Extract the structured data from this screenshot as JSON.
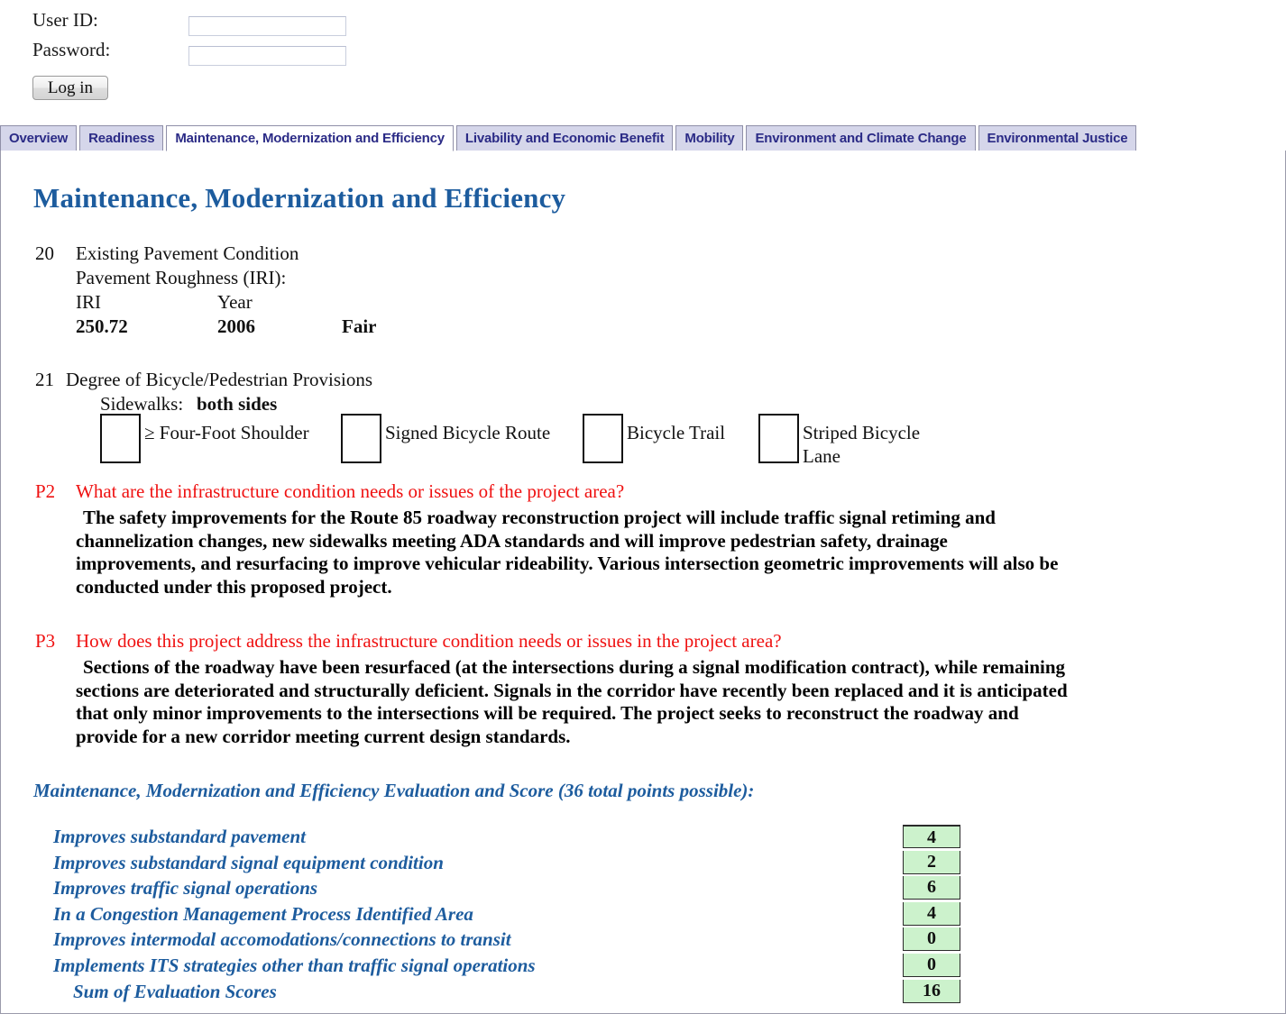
{
  "login": {
    "userid_label": "User ID:",
    "password_label": "Password:",
    "userid_value": "",
    "password_value": "",
    "userid_placeholder": "",
    "password_placeholder": "",
    "login_button": "Log in"
  },
  "tabs": [
    {
      "label": "Overview",
      "active": false
    },
    {
      "label": "Readiness",
      "active": false
    },
    {
      "label": "Maintenance, Modernization and Efficiency",
      "active": true
    },
    {
      "label": "Livability and Economic Benefit",
      "active": false
    },
    {
      "label": "Mobility",
      "active": false
    },
    {
      "label": "Environment and Climate Change",
      "active": false
    },
    {
      "label": "Environmental Justice",
      "active": false
    }
  ],
  "page": {
    "title": "Maintenance, Modernization and Efficiency"
  },
  "q20": {
    "number": "20",
    "title": "Existing Pavement Condition",
    "subtitle": "Pavement Roughness (IRI):",
    "header_iri": "IRI",
    "header_year": "Year",
    "value_iri": "250.72",
    "value_year": "2006",
    "value_rating": "Fair"
  },
  "q21": {
    "number": "21",
    "title": "Degree of Bicycle/Pedestrian Provisions",
    "sidewalks_label": "Sidewalks:",
    "sidewalks_value": "both sides",
    "checkboxes": [
      {
        "label": "≥ Four-Foot Shoulder",
        "checked": false
      },
      {
        "label": "Signed Bicycle Route",
        "checked": false
      },
      {
        "label": "Bicycle Trail",
        "checked": false
      },
      {
        "label": "Striped Bicycle Lane",
        "checked": false
      }
    ]
  },
  "p2": {
    "code": "P2",
    "question": "What are the infrastructure condition needs or issues of the project area?",
    "answer": "The safety improvements for the Route 85 roadway reconstruction project will include traffic signal retiming and channelization changes, new sidewalks meeting ADA standards and will improve pedestrian safety, drainage improvements, and resurfacing to improve vehicular rideability. Various intersection geometric improvements will also be conducted under this proposed project."
  },
  "p3": {
    "code": "P3",
    "question": "How does this project address the infrastructure condition needs or issues in the project area?",
    "answer": "Sections of the roadway have been resurfaced (at the intersections during a signal modification contract), while remaining sections are deteriorated and structurally deficient. Signals in the corridor have recently been replaced and it is anticipated that only minor improvements to the intersections will be required. The project seeks to reconstruct the roadway and provide for a new corridor meeting current design standards."
  },
  "evaluation": {
    "heading": "Maintenance, Modernization and Efficiency Evaluation and Score (36 total points possible):",
    "total_points_possible": 36,
    "rows": [
      {
        "label": "Improves substandard pavement",
        "score": "4"
      },
      {
        "label": "Improves substandard signal equipment condition",
        "score": "2"
      },
      {
        "label": "Improves traffic signal operations",
        "score": "6"
      },
      {
        "label": "In a Congestion Management Process Identified Area",
        "score": "4"
      },
      {
        "label": "Improves intermodal accomodations/connections to transit",
        "score": "0"
      },
      {
        "label": "Implements ITS strategies other than traffic signal operations",
        "score": "0"
      },
      {
        "label": "Sum of Evaluation Scores",
        "score": "16"
      }
    ]
  },
  "colors": {
    "heading_blue": "#1d5c9e",
    "question_red": "#ef1111",
    "tab_inactive_bg": "#d5d6ea",
    "tab_text": "#2b2b86",
    "score_bg": "#ccf2cc"
  }
}
